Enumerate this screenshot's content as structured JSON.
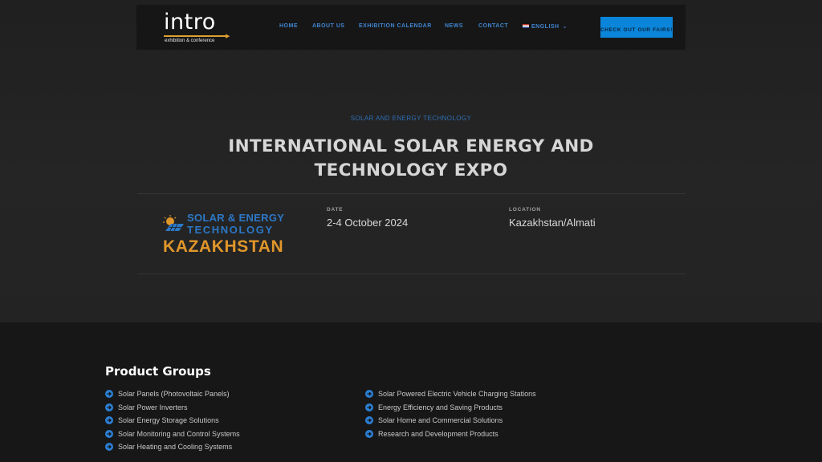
{
  "nav": {
    "logo": {
      "word": "intro",
      "tagline": "exhibition & conference"
    },
    "items": [
      "HOME",
      "ABOUT US",
      "EXHIBITION CALENDAR",
      "NEWS",
      "CONTACT"
    ],
    "language": "ENGLISH",
    "cta_label": "CHECK OUT OUR FAIRS!"
  },
  "hero": {
    "category": "SOLAR AND ENERGY TECHNOLOGY",
    "title": "INTERNATIONAL SOLAR ENERGY AND TECHNOLOGY EXPO",
    "expo_logo": {
      "line1": "SOLAR & ENERGY",
      "line2": "TECHNOLOGY",
      "line3": "KAZAKHSTAN"
    },
    "date_label": "DATE",
    "date_value": "2-4 October 2024",
    "location_label": "LOCATION",
    "location_value": "Kazakhstan/Almati"
  },
  "product_groups": {
    "title": "Product Groups",
    "left": [
      "Solar Panels (Photovoltaic Panels)",
      "Solar Power Inverters",
      "Solar Energy Storage Solutions",
      "Solar Monitoring and Control Systems",
      "Solar Heating and Cooling Systems"
    ],
    "right": [
      "Solar Powered Electric Vehicle Charging Stations",
      "Energy Efficiency and Saving Products",
      "Solar Home and Commercial Solutions",
      "Research and Development Products"
    ]
  },
  "colors": {
    "accent": "#0a85d9",
    "nav_link": "#3f86d1",
    "logo_orange": "#e0962a"
  },
  "icons": {
    "list_bullet": "arrow-circle-right-icon",
    "language_chevron": "chevron-down-icon"
  }
}
